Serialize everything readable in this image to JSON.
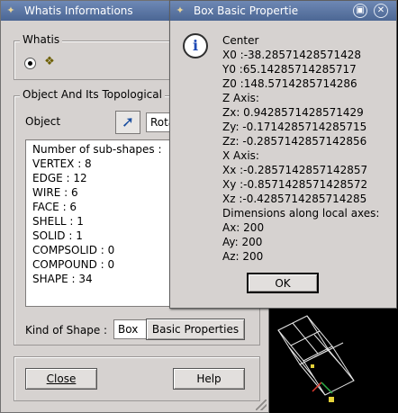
{
  "whatis_window": {
    "title": "Whatis Informations",
    "whatis_group_title": "Whatis",
    "object_group_title": "Object And Its Topological",
    "object_label": "Object",
    "object_value": "Rota",
    "subshapes": [
      "Number of sub-shapes :",
      "VERTEX : 8",
      "EDGE : 12",
      "WIRE : 6",
      "FACE : 6",
      "SHELL : 1",
      "SOLID : 1",
      "COMPSOLID : 0",
      "COMPOUND : 0",
      "SHAPE : 34"
    ],
    "kind_label": "Kind of Shape :",
    "kind_value": "Box",
    "basic_properties_button": "Basic Properties",
    "close_button": "Close",
    "help_button": "Help"
  },
  "box_dialog": {
    "title": "Box Basic Propertie",
    "lines": [
      "Center",
      "X0 :-38.28571428571428",
      "Y0 :65.14285714285717",
      "Z0 :148.5714285714286",
      "Z Axis:",
      "Zx: 0.9428571428571429",
      "Zy: -0.1714285714285715",
      "Zz: -0.2857142857142856",
      "X Axis:",
      "Xx :-0.2857142857142857",
      "Xy :-0.8571428571428572",
      "Xz :-0.4285714285714285",
      "Dimensions along local axes:",
      "Ax: 200",
      "Ay: 200",
      "Az: 200"
    ],
    "ok_button": "OK"
  },
  "icons": {
    "title_icon": "window-menu-icon",
    "vertex_icon": "vertex-icon",
    "select_icon": "select-arrow-icon",
    "info_icon": "info-icon",
    "minimize_icon": "minimize-icon",
    "close_icon": "close-icon"
  },
  "colors": {
    "titlebar": "#5a76a5",
    "dialog_bg": "#d6d2d0",
    "viewer_bg": "#000000"
  }
}
